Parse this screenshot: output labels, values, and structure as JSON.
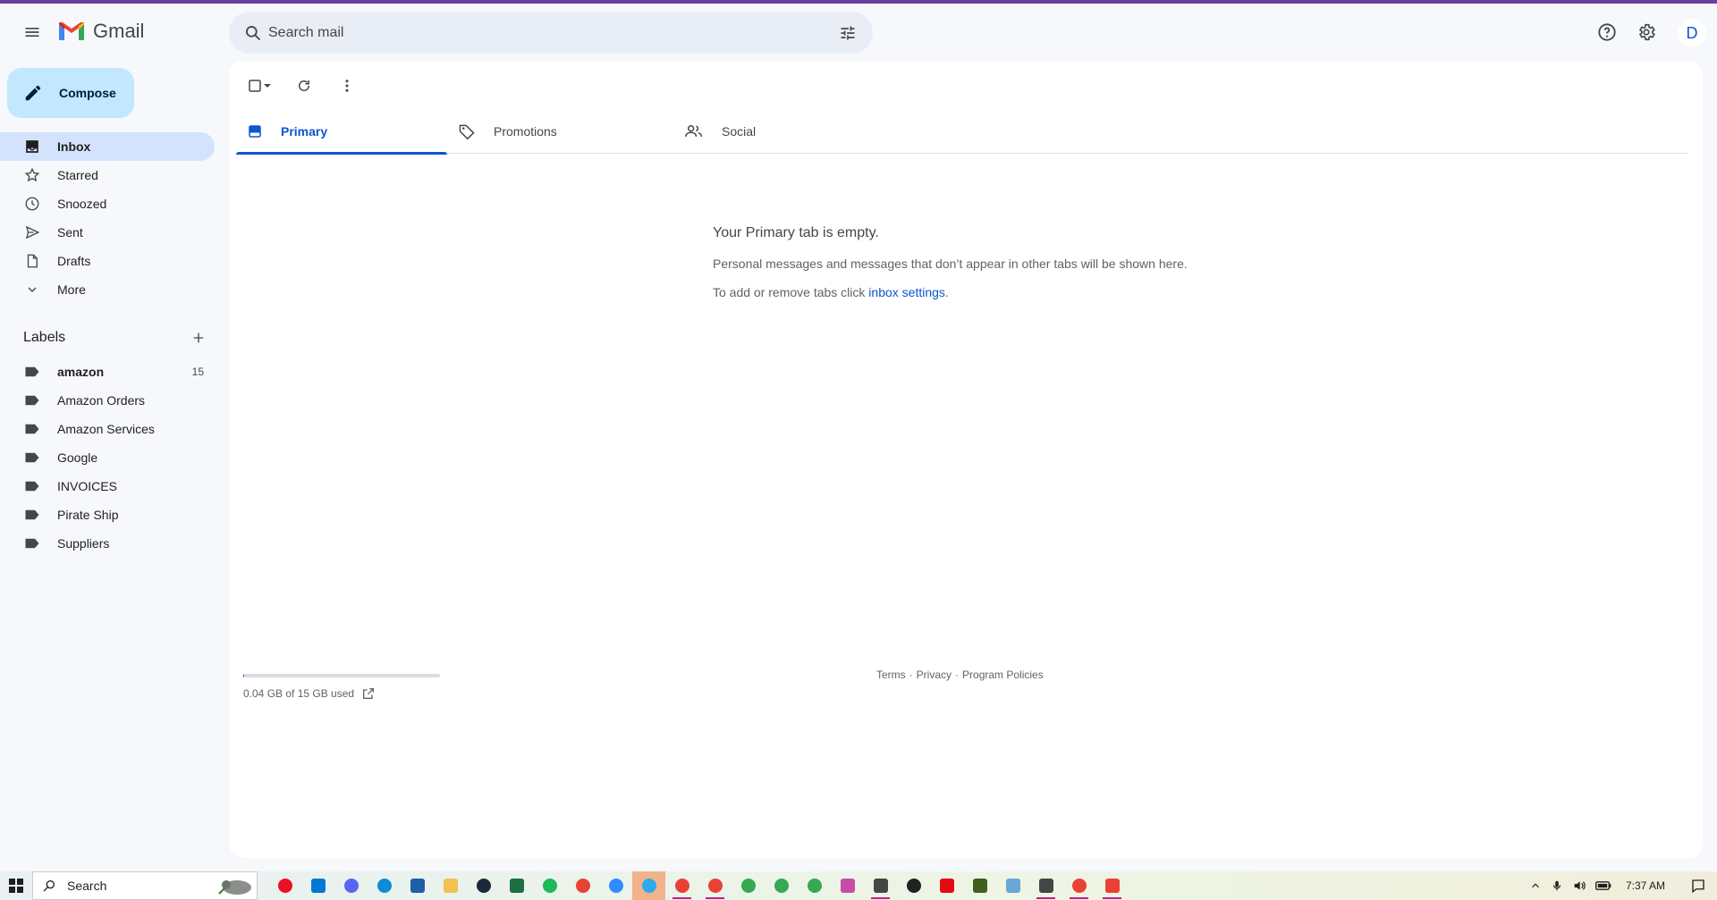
{
  "app": {
    "name": "Gmail"
  },
  "search": {
    "placeholder": "Search mail"
  },
  "header": {
    "avatar_letter": "D"
  },
  "compose": {
    "label": "Compose"
  },
  "nav": {
    "items": [
      {
        "label": "Inbox",
        "icon": "inbox-icon",
        "active": true
      },
      {
        "label": "Starred",
        "icon": "star-icon"
      },
      {
        "label": "Snoozed",
        "icon": "clock-icon"
      },
      {
        "label": "Sent",
        "icon": "send-icon"
      },
      {
        "label": "Drafts",
        "icon": "draft-icon"
      },
      {
        "label": "More",
        "icon": "chevron-down-icon"
      }
    ]
  },
  "labels": {
    "title": "Labels",
    "items": [
      {
        "label": "amazon",
        "count": "15",
        "bold": true
      },
      {
        "label": "Amazon Orders"
      },
      {
        "label": "Amazon Services"
      },
      {
        "label": "Google"
      },
      {
        "label": "INVOICES"
      },
      {
        "label": "Pirate Ship"
      },
      {
        "label": "Suppliers"
      }
    ]
  },
  "tabs": [
    {
      "label": "Primary",
      "icon": "inbox-tab-icon",
      "active": true
    },
    {
      "label": "Promotions",
      "icon": "tag-icon"
    },
    {
      "label": "Social",
      "icon": "people-icon"
    }
  ],
  "empty_state": {
    "title": "Your Primary tab is empty.",
    "line1": "Personal messages and messages that don’t appear in other tabs will be shown here.",
    "line2_prefix": "To add or remove tabs click ",
    "line2_link": "inbox settings",
    "line2_suffix": "."
  },
  "storage": {
    "text": "0.04 GB of 15 GB used",
    "fraction": 0.003
  },
  "footer": {
    "terms": "Terms",
    "sep1": "·",
    "privacy": "Privacy",
    "sep2": "·",
    "policies": "Program Policies"
  },
  "taskbar": {
    "search_label": "Search",
    "time": "7:37 AM",
    "apps": [
      {
        "name": "cast-app",
        "color": "#e81123"
      },
      {
        "name": "mail-app",
        "color": "#0078d4"
      },
      {
        "name": "discord-app",
        "color": "#5865f2"
      },
      {
        "name": "edge-app",
        "color": "#0c8dd6"
      },
      {
        "name": "store-app",
        "color": "#1f5fa8"
      },
      {
        "name": "files-app",
        "color": "#f2c14e"
      },
      {
        "name": "steam-app",
        "color": "#1b2838"
      },
      {
        "name": "excel-app",
        "color": "#1d6f42"
      },
      {
        "name": "spotify-app",
        "color": "#1db954"
      },
      {
        "name": "chrome-app",
        "color": "#e94235"
      },
      {
        "name": "zoom-app",
        "color": "#2d8cff"
      },
      {
        "name": "telegram-app",
        "color": "#2aabee",
        "active": true
      },
      {
        "name": "chrome-app-2",
        "color": "#e94235",
        "running": true
      },
      {
        "name": "chrome-app-3",
        "color": "#e94235",
        "running": true
      },
      {
        "name": "chrome-app-4",
        "color": "#34a853"
      },
      {
        "name": "chrome-app-5",
        "color": "#34a853"
      },
      {
        "name": "chrome-app-6",
        "color": "#34a853"
      },
      {
        "name": "paint-app",
        "color": "#c94ca8"
      },
      {
        "name": "calculator-app",
        "color": "#444746",
        "running": true
      },
      {
        "name": "obs-app",
        "color": "#222222"
      },
      {
        "name": "netflix-app",
        "color": "#e50914"
      },
      {
        "name": "sticky-app",
        "color": "#3f5f1f"
      },
      {
        "name": "notepad-app",
        "color": "#6aa6d6"
      },
      {
        "name": "settings-app",
        "color": "#444746",
        "running": true
      },
      {
        "name": "chrome-app-7",
        "color": "#e94235",
        "running": true
      },
      {
        "name": "snip-app",
        "color": "#e94235",
        "running": true
      }
    ]
  }
}
